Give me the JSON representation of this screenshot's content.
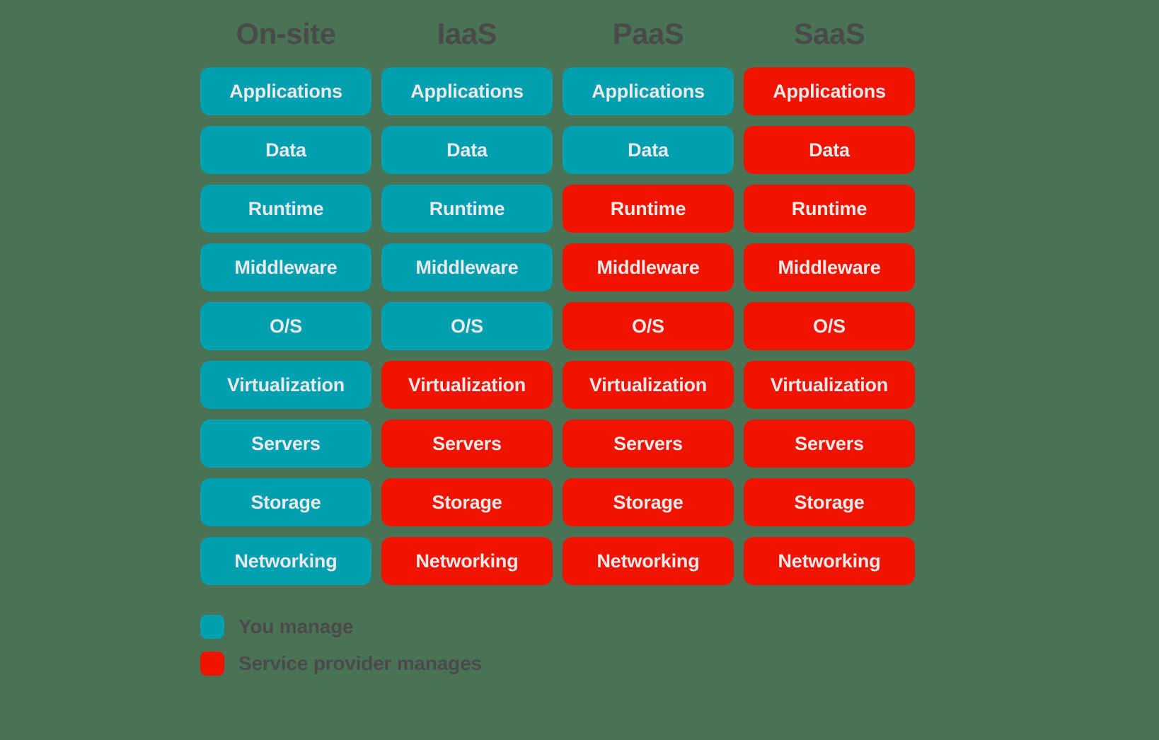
{
  "colors": {
    "background": "#4a7355",
    "self_managed": "#00a0b0",
    "provider_managed": "#f01400",
    "cell_text": "#e9e9e9",
    "header_text": "#4a4a4a"
  },
  "columns": [
    {
      "header": "On-site"
    },
    {
      "header": "IaaS"
    },
    {
      "header": "PaaS"
    },
    {
      "header": "SaaS"
    }
  ],
  "layers": [
    "Applications",
    "Data",
    "Runtime",
    "Middleware",
    "O/S",
    "Virtualization",
    "Servers",
    "Storage",
    "Networking"
  ],
  "legend": {
    "items": [
      {
        "label": "You manage",
        "key": "self"
      },
      {
        "label": "Service provider manages",
        "key": "provider"
      }
    ]
  },
  "chart_data": {
    "type": "table",
    "title": "",
    "categories": [
      "On-site",
      "IaaS",
      "PaaS",
      "SaaS"
    ],
    "rows": [
      "Applications",
      "Data",
      "Runtime",
      "Middleware",
      "O/S",
      "Virtualization",
      "Servers",
      "Storage",
      "Networking"
    ],
    "legend_entries": [
      "You manage",
      "Service provider manages"
    ],
    "cells": [
      {
        "row": "Applications",
        "values": [
          "self",
          "self",
          "self",
          "provider"
        ]
      },
      {
        "row": "Data",
        "values": [
          "self",
          "self",
          "self",
          "provider"
        ]
      },
      {
        "row": "Runtime",
        "values": [
          "self",
          "self",
          "provider",
          "provider"
        ]
      },
      {
        "row": "Middleware",
        "values": [
          "self",
          "self",
          "provider",
          "provider"
        ]
      },
      {
        "row": "O/S",
        "values": [
          "self",
          "self",
          "provider",
          "provider"
        ]
      },
      {
        "row": "Virtualization",
        "values": [
          "self",
          "provider",
          "provider",
          "provider"
        ]
      },
      {
        "row": "Servers",
        "values": [
          "self",
          "provider",
          "provider",
          "provider"
        ]
      },
      {
        "row": "Storage",
        "values": [
          "self",
          "provider",
          "provider",
          "provider"
        ]
      },
      {
        "row": "Networking",
        "values": [
          "self",
          "provider",
          "provider",
          "provider"
        ]
      }
    ]
  }
}
